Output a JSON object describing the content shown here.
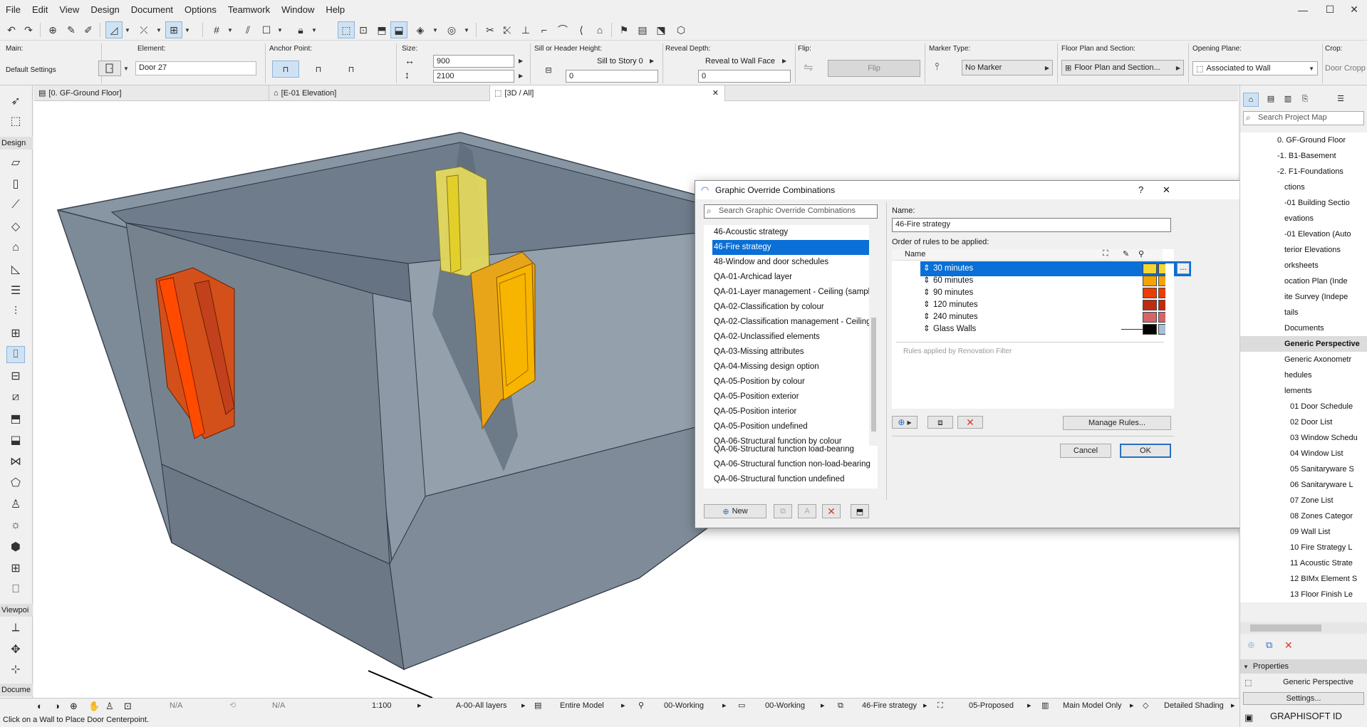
{
  "menu": [
    "File",
    "Edit",
    "View",
    "Design",
    "Document",
    "Options",
    "Teamwork",
    "Window",
    "Help"
  ],
  "window_controls": {
    "minimize": "—",
    "maximize": "☐",
    "close": "✕"
  },
  "infobox": {
    "main_label": "Main:",
    "main_value": "Default Settings",
    "element_label": "Element:",
    "element_value": "Door 27",
    "anchor_label": "Anchor Point:",
    "size_label": "Size:",
    "size_width": "900",
    "size_height": "2100",
    "sill_label": "Sill or Header Height:",
    "sill_mode": "Sill to Story 0",
    "sill_value": "0",
    "reveal_label": "Reveal Depth:",
    "reveal_mode": "Reveal to Wall Face",
    "reveal_value": "0",
    "flip_label": "Flip:",
    "flip_button": "Flip",
    "marker_label": "Marker Type:",
    "marker_value": "No Marker",
    "fps_label": "Floor Plan and Section:",
    "fps_value": "Floor Plan and Section...",
    "opening_label": "Opening Plane:",
    "opening_value": "Associated to Wall",
    "crop_label": "Crop:",
    "crop_value": "Door Cropp"
  },
  "tabs": [
    "[0. GF-Ground Floor]",
    "[E-01 Elevation]",
    "[3D / All]"
  ],
  "toolbox": {
    "design_header": "Design",
    "viewpoint_header": "Viewpoi",
    "document_header": "Docume"
  },
  "dialog": {
    "title": "Graphic Override Combinations",
    "help": "?",
    "close": "✕",
    "search_placeholder": "Search Graphic Override Combinations",
    "list": [
      "46-Acoustic strategy",
      "46-Fire strategy",
      "48-Window and door schedules",
      "QA-01-Archicad layer",
      "QA-01-Layer management - Ceiling (sample)",
      "QA-02-Classification by colour",
      "QA-02-Classification management - Ceiling (sample)",
      "QA-02-Unclassified elements",
      "QA-03-Missing attributes",
      "QA-04-Missing design option",
      "QA-05-Position by colour",
      "QA-05-Position exterior",
      "QA-05-Position interior",
      "QA-05-Position undefined",
      "QA-06-Structural function by colour",
      "QA-06-Structural function load-bearing",
      "QA-06-Structural function non-load-bearing",
      "QA-06-Structural function undefined"
    ],
    "selected_index": 1,
    "new_button": "New",
    "name_label": "Name:",
    "name_value": "46-Fire strategy",
    "order_label": "Order of rules to be applied:",
    "col_name": "Name",
    "rules": [
      {
        "name": "30 minutes",
        "fill": "#f5d532",
        "fill2": "#f5d532"
      },
      {
        "name": "60 minutes",
        "fill": "#f5a300",
        "fill2": "#f5a300"
      },
      {
        "name": "90 minutes",
        "fill": "#ee3b00",
        "fill2": "#ee3b00"
      },
      {
        "name": "120 minutes",
        "fill": "#c02b10",
        "fill2": "#c02b10"
      },
      {
        "name": "240 minutes",
        "fill": "#d7646a",
        "fill2": "#d7646a"
      },
      {
        "name": "Glass Walls",
        "fill": "#000000",
        "fill2": "#a6c0dc"
      }
    ],
    "ellipsis": "...",
    "renovation_text": "Rules applied by Renovation Filter",
    "manage_button": "Manage Rules...",
    "cancel_button": "Cancel",
    "ok_button": "OK"
  },
  "navigator": {
    "search_placeholder": "Search Project Map",
    "items": [
      "0. GF-Ground Floor",
      "-1. B1-Basement",
      "-2. F1-Foundations",
      "ctions",
      "-01 Building Sectio",
      "evations",
      "-01 Elevation (Auto",
      "terior Elevations",
      "orksheets",
      "ocation Plan (Inde",
      "ite Survey (Indepe",
      "tails",
      "Documents",
      "Generic Perspective",
      "Generic Axonometr",
      "hedules",
      "lements",
      "01 Door Schedule",
      "02 Door List",
      "03 Window Schedu",
      "04 Window List",
      "05 Sanitaryware S",
      "06 Sanitaryware L",
      "07 Zone List",
      "08 Zones Categor",
      "09 Wall List",
      "10 Fire Strategy L",
      "11 Acoustic Strate",
      "12 BIMx Element S",
      "13 Floor Finish Le"
    ],
    "properties_header": "Properties",
    "properties_value": "Generic Perspective",
    "settings_button": "Settings...",
    "brand": "GRAPHISOFT ID"
  },
  "status": {
    "na1": "N/A",
    "na2": "N/A",
    "scale": "1:100",
    "layers": "A-00-All layers",
    "model": "Entire Model",
    "pen": "00-Working",
    "pen2": "00-Working",
    "override": "46-Fire strategy",
    "renovation": "05-Proposed",
    "model_only": "Main Model Only",
    "shading": "Detailed Shading"
  },
  "hint": "Click on a Wall to Place Door Centerpoint."
}
